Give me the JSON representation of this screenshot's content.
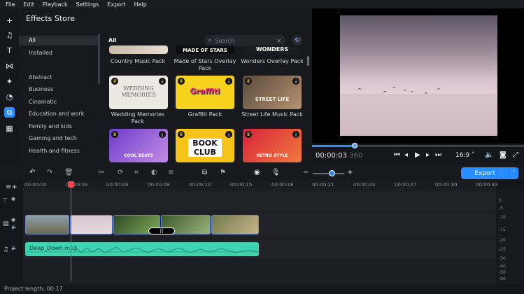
{
  "menu": [
    "File",
    "Edit",
    "Playback",
    "Settings",
    "Export",
    "Help"
  ],
  "store": {
    "title": "Effects Store",
    "categories": [
      "All",
      "Installed",
      "Abstract",
      "Business",
      "Cinematic",
      "Education and work",
      "Family and kids",
      "Gaming and tech",
      "Health and fitness"
    ],
    "grid_heading": "All",
    "search_placeholder": "Search",
    "packs": [
      {
        "name": "Country Music Pack",
        "thumb": ""
      },
      {
        "name": "Made of Stars Overlay Pack",
        "thumb": "MADE OF STARS"
      },
      {
        "name": "Wonders Overlay Pack",
        "thumb": "WONDERS"
      },
      {
        "name": "Wedding Memories Pack",
        "thumb": "WEDDING MEMORIES"
      },
      {
        "name": "Graffiti Pack",
        "thumb": "Graffiti"
      },
      {
        "name": "Street Life Music Pack",
        "thumb": "STREET LIFE"
      },
      {
        "name": "",
        "thumb": "COOL BEATS"
      },
      {
        "name": "",
        "thumb": "BOOK CLUB"
      },
      {
        "name": "",
        "thumb": "RETRO STYLE"
      }
    ]
  },
  "player": {
    "timecode": "00:00:03",
    "timecode_ms": ".360",
    "aspect": "16:9",
    "progress": 0.2
  },
  "toolbar": {
    "export_label": "Export",
    "zoom_level": 0.6
  },
  "timeline": {
    "ticks": [
      "00:00:00",
      "00:00:03",
      "00:00:06",
      "00:00:09",
      "00:00:12",
      "00:00:15",
      "00:00:18",
      "00:00:21",
      "00:00:24",
      "00:00:27",
      "00:00:30",
      "00:00:33"
    ],
    "audio_clip": "Deep_Down.mp3"
  },
  "meter_labels": [
    "0",
    "-5",
    "-10",
    "-15",
    "-20",
    "-25",
    "-30",
    "-40",
    "-50",
    "-60"
  ],
  "status": "Project length: 00:17",
  "colors": {
    "accent": "#2a8dff",
    "audio": "#3fd3b1",
    "playhead": "#ff3f47"
  }
}
